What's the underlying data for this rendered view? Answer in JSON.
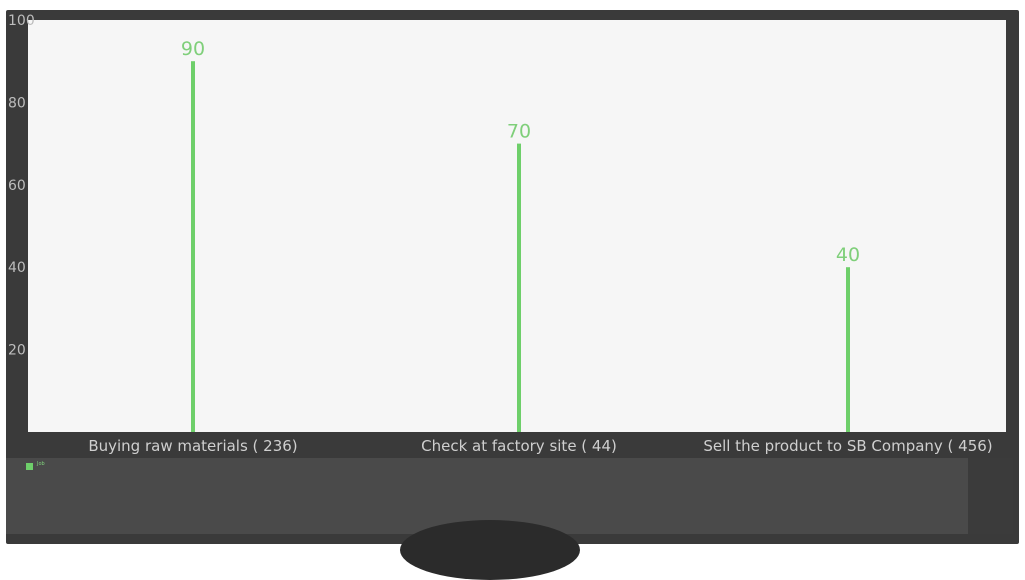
{
  "chart_data": {
    "type": "bar",
    "categories": [
      "Buying raw materials ( 236)",
      "Check at factory site ( 44)",
      "Sell the product to SB Company ( 456)"
    ],
    "values": [
      90,
      70,
      40
    ],
    "ylim": [
      0,
      100
    ],
    "yticks": [
      20,
      40,
      60,
      80,
      100
    ],
    "grid": false,
    "bar_color": "#6ecf6a",
    "legend": {
      "position": "bottom-left"
    }
  },
  "legend_label": "Job"
}
